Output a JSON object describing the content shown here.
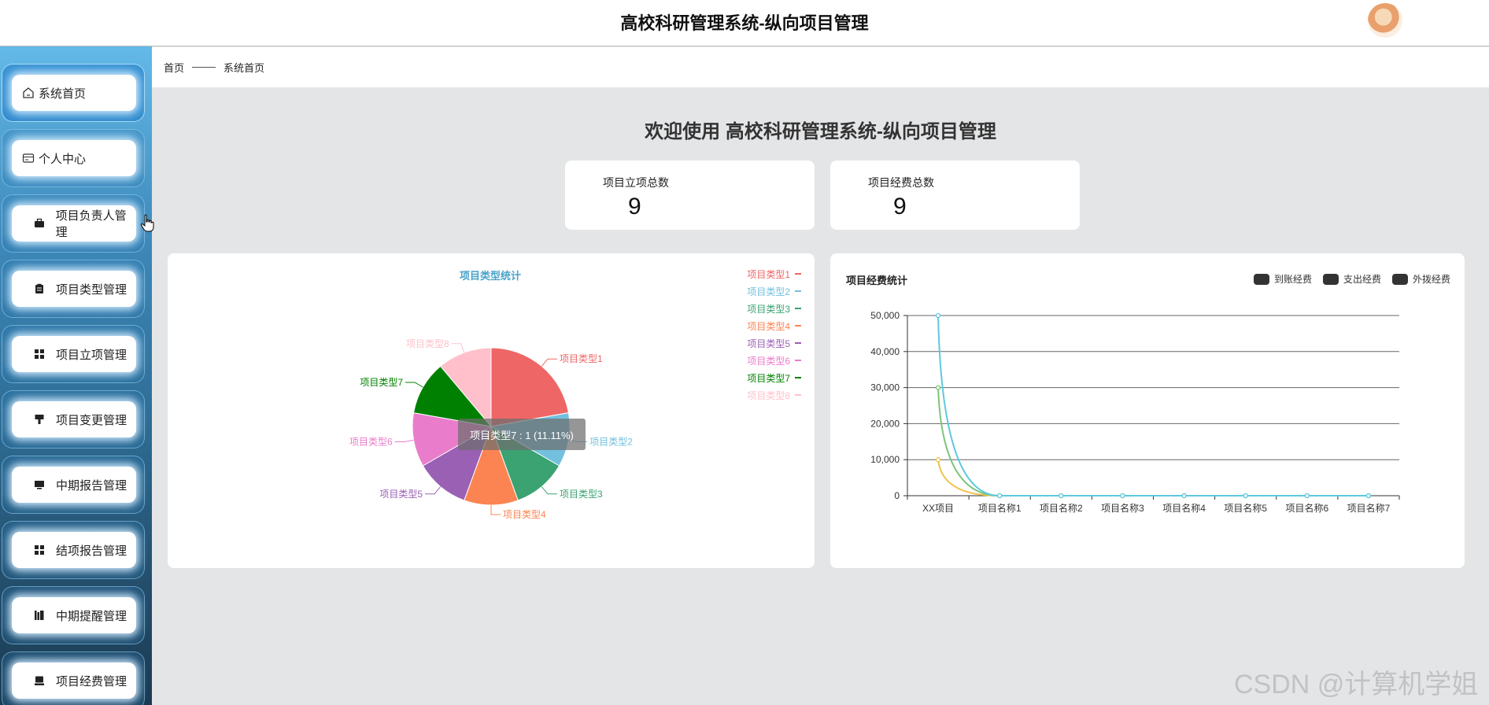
{
  "header": {
    "title": "高校科研管理系统-纵向项目管理",
    "avatar_icon": "user-avatar-icon"
  },
  "sidebar": {
    "items": [
      {
        "label": "系统首页",
        "icon": "home-icon",
        "active": true
      },
      {
        "label": "个人中心",
        "icon": "profile-card-icon"
      },
      {
        "label": "项目负责人管理",
        "icon": "briefcase-icon"
      },
      {
        "label": "项目类型管理",
        "icon": "clipboard-icon"
      },
      {
        "label": "项目立项管理",
        "icon": "grid-icon"
      },
      {
        "label": "项目变更管理",
        "icon": "paint-roller-icon"
      },
      {
        "label": "中期报告管理",
        "icon": "monitor-icon"
      },
      {
        "label": "结项报告管理",
        "icon": "grid-icon"
      },
      {
        "label": "中期提醒管理",
        "icon": "books-icon"
      },
      {
        "label": "项目经费管理",
        "icon": "printer-icon"
      }
    ]
  },
  "breadcrumb": {
    "home": "首页",
    "current": "系统首页"
  },
  "welcome": "欢迎使用 高校科研管理系统-纵向项目管理",
  "stats": [
    {
      "label": "项目立项总数",
      "value": "9"
    },
    {
      "label": "项目经费总数",
      "value": "9"
    }
  ],
  "chart_data": [
    {
      "type": "pie",
      "title": "项目类型统计",
      "categories": [
        "项目类型1",
        "项目类型2",
        "项目类型3",
        "项目类型4",
        "项目类型5",
        "项目类型6",
        "项目类型7",
        "项目类型8"
      ],
      "values": [
        2,
        1,
        1,
        1,
        1,
        1,
        1,
        1
      ],
      "colors": [
        "#ee6666",
        "#73c0de",
        "#3ba272",
        "#fc8452",
        "#9a60b4",
        "#ea7ccc",
        "#008000",
        "#ffc0cb"
      ],
      "legend": "right",
      "tooltip": "项目类型7 : 1 (11.11%)"
    },
    {
      "type": "line",
      "title": "项目经费统计",
      "categories": [
        "XX项目",
        "项目名称1",
        "项目名称2",
        "项目名称3",
        "项目名称4",
        "项目名称5",
        "项目名称6",
        "项目名称7"
      ],
      "series": [
        {
          "name": "到账经费",
          "values": [
            50000,
            0,
            0,
            0,
            0,
            0,
            0,
            0
          ],
          "color": "#5ec8e0"
        },
        {
          "name": "支出经费",
          "values": [
            30000,
            0,
            0,
            0,
            0,
            0,
            0,
            0
          ],
          "color": "#7cc47a"
        },
        {
          "name": "外拨经费",
          "values": [
            10000,
            0,
            0,
            0,
            0,
            0,
            0,
            0
          ],
          "color": "#f0c24b"
        }
      ],
      "yticks": [
        "0",
        "10,000",
        "20,000",
        "30,000",
        "40,000",
        "50,000"
      ],
      "ylim": [
        0,
        50000
      ],
      "legend": "top-right",
      "grid": true
    }
  ],
  "watermark": "CSDN @计算机学姐"
}
